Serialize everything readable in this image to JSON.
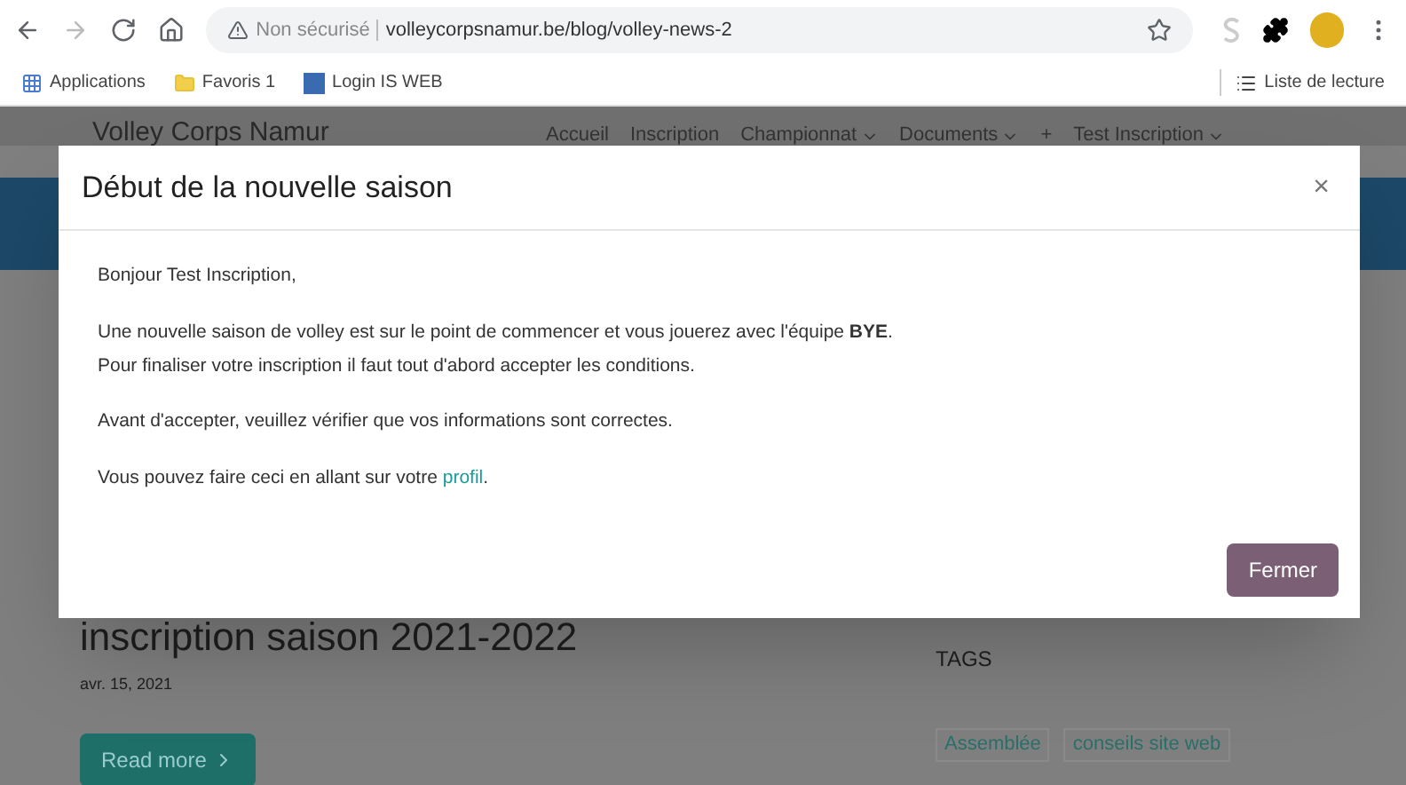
{
  "browser": {
    "address": {
      "warning": "Non sécurisé",
      "url": "volleycorpsnamur.be/blog/volley-news-2"
    },
    "bookmarks": [
      {
        "label": "Applications",
        "kind": "apps"
      },
      {
        "label": "Favoris 1",
        "kind": "folder"
      },
      {
        "label": "Login IS WEB",
        "kind": "site"
      }
    ],
    "reading_list": "Liste de lecture"
  },
  "site": {
    "title": "Volley Corps Namur",
    "nav": [
      {
        "label": "Accueil",
        "dropdown": false
      },
      {
        "label": "Inscription",
        "dropdown": false
      },
      {
        "label": "Championnat",
        "dropdown": true
      },
      {
        "label": "Documents",
        "dropdown": true
      },
      {
        "label": "+",
        "dropdown": false
      },
      {
        "label": "Test Inscription",
        "dropdown": true
      }
    ]
  },
  "post": {
    "title": "inscription saison 2021-2022",
    "date": "avr. 15, 2021",
    "button": "Read more"
  },
  "tags": {
    "heading": "TAGS",
    "items": [
      "Assemblée",
      "conseils site web"
    ]
  },
  "modal": {
    "title": "Début de la nouvelle saison",
    "close": "×",
    "paragraphs": [
      [
        "Bonjour Test Inscription,"
      ],
      [
        "Une nouvelle saison de volley est sur le point de commencer et vous jouerez avec l'équipe **BYE**.",
        "Pour finaliser votre inscription il faut tout d'abord accepter les conditions."
      ],
      [
        "Avant d'accepter, veuillez vérifier que vos informations sont correctes."
      ]
    ],
    "link_sentence": {
      "text": "Vous pouvez faire ceci en allant sur votre ",
      "link": "profil",
      "end": "."
    },
    "button": "Fermer"
  }
}
